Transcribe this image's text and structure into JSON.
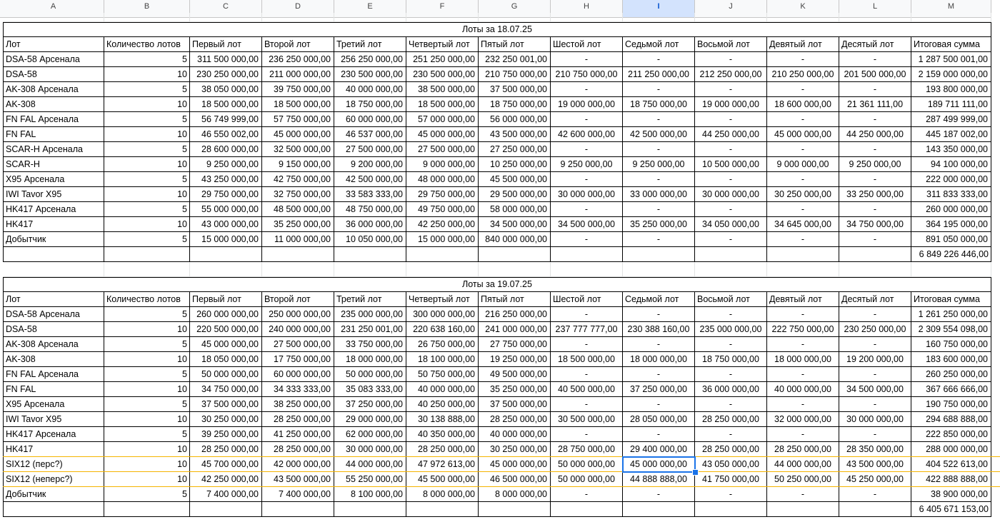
{
  "columns": [
    "A",
    "B",
    "C",
    "D",
    "E",
    "F",
    "G",
    "H",
    "I",
    "J",
    "K",
    "L",
    "M"
  ],
  "selected_column": "I",
  "headers": [
    "Лот",
    "Количество лотов",
    "Первый лот",
    "Второй лот",
    "Третий лот",
    "Четвертый лот",
    "Пятый лот",
    "Шестой лот",
    "Седьмой лот",
    "Восьмой лот",
    "Девятый лот",
    "Десятый лот",
    "Итоговая сумма"
  ],
  "tables": [
    {
      "title": "Лоты за 18.07.25",
      "rows": [
        [
          "DSA-58 Арсенала",
          "5",
          "311 500 000,00",
          "236 250 000,00",
          "256 250 000,00",
          "251 250 000,00",
          "232 250 001,00",
          "-",
          "-",
          "-",
          "-",
          "-",
          "1 287 500 001,00"
        ],
        [
          "DSA-58",
          "10",
          "230 250 000,00",
          "211 000 000,00",
          "230 500 000,00",
          "230 500 000,00",
          "210 750 000,00",
          "210 750 000,00",
          "211 250 000,00",
          "212 250 000,00",
          "210 250 000,00",
          "201 500 000,00",
          "2 159 000 000,00"
        ],
        [
          "AK-308 Арсенала",
          "5",
          "38 050 000,00",
          "39 750 000,00",
          "40 000 000,00",
          "38 500 000,00",
          "37 500 000,00",
          "-",
          "-",
          "-",
          "-",
          "-",
          "193 800 000,00"
        ],
        [
          "AK-308",
          "10",
          "18 500 000,00",
          "18 500 000,00",
          "18 750 000,00",
          "18 500 000,00",
          "18 750 000,00",
          "19 000 000,00",
          "18 750 000,00",
          "19 000 000,00",
          "18 600 000,00",
          "21 361 111,00",
          "189 711 111,00"
        ],
        [
          "FN FAL Арсенала",
          "5",
          "56 749 999,00",
          "57 750 000,00",
          "60 000 000,00",
          "57 000 000,00",
          "56 000 000,00",
          "-",
          "-",
          "-",
          "-",
          "-",
          "287 499 999,00"
        ],
        [
          "FN FAL",
          "10",
          "46 550 002,00",
          "45 000 000,00",
          "46 537 000,00",
          "45 000 000,00",
          "43 500 000,00",
          "42 600 000,00",
          "42 500 000,00",
          "44 250 000,00",
          "45 000 000,00",
          "44 250 000,00",
          "445 187 002,00"
        ],
        [
          "SCAR-H Арсенала",
          "5",
          "28 600 000,00",
          "32 500 000,00",
          "27 500 000,00",
          "27 500 000,00",
          "27 250 000,00",
          "-",
          "-",
          "-",
          "-",
          "-",
          "143 350 000,00"
        ],
        [
          "SCAR-H",
          "10",
          "9 250 000,00",
          "9 150 000,00",
          "9 200 000,00",
          "9 000 000,00",
          "10 250 000,00",
          "9 250 000,00",
          "9 250 000,00",
          "10 500 000,00",
          "9 000 000,00",
          "9 250 000,00",
          "94 100 000,00"
        ],
        [
          "X95 Арсенала",
          "5",
          "43 250 000,00",
          "42 750 000,00",
          "42 500 000,00",
          "48 000 000,00",
          "45 500 000,00",
          "-",
          "-",
          "-",
          "-",
          "-",
          "222 000 000,00"
        ],
        [
          "IWI Tavor X95",
          "10",
          "29 750 000,00",
          "32 750 000,00",
          "33 583 333,00",
          "29 750 000,00",
          "29 500 000,00",
          "30 000 000,00",
          "33 000 000,00",
          "30 000 000,00",
          "30 250 000,00",
          "33 250 000,00",
          "311 833 333,00"
        ],
        [
          "HK417 Арсенала",
          "5",
          "55 000 000,00",
          "48 500 000,00",
          "48 750 000,00",
          "49 750 000,00",
          "58 000 000,00",
          "-",
          "-",
          "-",
          "-",
          "-",
          "260 000 000,00"
        ],
        [
          "HK417",
          "10",
          "43 000 000,00",
          "35 250 000,00",
          "36 000 000,00",
          "42 250 000,00",
          "34 500 000,00",
          "34 500 000,00",
          "35 250 000,00",
          "34 050 000,00",
          "34 645 000,00",
          "34 750 000,00",
          "364 195 000,00"
        ],
        [
          "Добытчик",
          "5",
          "15 000 000,00",
          "11 000 000,00",
          "10 050 000,00",
          "15 000 000,00",
          "840 000 000,00",
          "-",
          "-",
          "-",
          "-",
          "-",
          "891 050 000,00"
        ]
      ],
      "total": "6 849 226 446,00"
    },
    {
      "title": "Лоты за 19.07.25",
      "rows": [
        [
          "DSA-58 Арсенала",
          "5",
          "260 000 000,00",
          "250 000 000,00",
          "235 000 000,00",
          "300 000 000,00",
          "216 250 000,00",
          "-",
          "-",
          "-",
          "-",
          "-",
          "1 261 250 000,00"
        ],
        [
          "DSA-58",
          "10",
          "220 500 000,00",
          "240 000 000,00",
          "231 250 001,00",
          "220 638 160,00",
          "241 000 000,00",
          "237 777 777,00",
          "230 388 160,00",
          "235 000 000,00",
          "222 750 000,00",
          "230 250 000,00",
          "2 309 554 098,00"
        ],
        [
          "AK-308 Арсенала",
          "5",
          "45 000 000,00",
          "27 500 000,00",
          "33 750 000,00",
          "26 750 000,00",
          "27 750 000,00",
          "-",
          "-",
          "-",
          "-",
          "-",
          "160 750 000,00"
        ],
        [
          "AK-308",
          "10",
          "18 050 000,00",
          "17 750 000,00",
          "18 000 000,00",
          "18 100 000,00",
          "19 250 000,00",
          "18 500 000,00",
          "18 000 000,00",
          "18 750 000,00",
          "18 000 000,00",
          "19 200 000,00",
          "183 600 000,00"
        ],
        [
          "FN FAL Арсенала",
          "5",
          "50 000 000,00",
          "60 000 000,00",
          "50 000 000,00",
          "50 750 000,00",
          "49 500 000,00",
          "-",
          "-",
          "-",
          "-",
          "-",
          "260 250 000,00"
        ],
        [
          "FN FAL",
          "10",
          "34 750 000,00",
          "34 333 333,00",
          "35 083 333,00",
          "40 000 000,00",
          "35 250 000,00",
          "40 500 000,00",
          "37 250 000,00",
          "36 000 000,00",
          "40 000 000,00",
          "34 500 000,00",
          "367 666 666,00"
        ],
        [
          "X95 Арсенала",
          "5",
          "37 500 000,00",
          "38 250 000,00",
          "37 250 000,00",
          "40 250 000,00",
          "37 500 000,00",
          "-",
          "-",
          "-",
          "-",
          "-",
          "190 750 000,00"
        ],
        [
          "IWI Tavor X95",
          "10",
          "30 250 000,00",
          "28 250 000,00",
          "29 000 000,00",
          "30 138 888,00",
          "28 250 000,00",
          "30 500 000,00",
          "28 050 000,00",
          "28 250 000,00",
          "32 000 000,00",
          "30 000 000,00",
          "294 688 888,00"
        ],
        [
          "HK417 Арсенала",
          "5",
          "39 250 000,00",
          "41 250 000,00",
          "62 000 000,00",
          "40 350 000,00",
          "40 000 000,00",
          "-",
          "-",
          "-",
          "-",
          "-",
          "222 850 000,00"
        ],
        [
          "HK417",
          "10",
          "28 250 000,00",
          "28 250 000,00",
          "30 000 000,00",
          "28 250 000,00",
          "30 250 000,00",
          "28 750 000,00",
          "29 400 000,00",
          "28 250 000,00",
          "28 250 000,00",
          "28 350 000,00",
          "288 000 000,00"
        ],
        [
          "SIX12 (перс?)",
          "10",
          "45 700 000,00",
          "42 000 000,00",
          "44 000 000,00",
          "47 972 613,00",
          "45 000 000,00",
          "50 000 000,00",
          "45 000 000,00",
          "43 050 000,00",
          "44 000 000,00",
          "43 500 000,00",
          "404 522 613,00"
        ],
        [
          "SIX12 (неперс?)",
          "10",
          "42 250 000,00",
          "43 500 000,00",
          "55 250 000,00",
          "45 500 000,00",
          "46 500 000,00",
          "50 000 000,00",
          "44 888 888,00",
          "41 750 000,00",
          "50 250 000,00",
          "45 250 000,00",
          "422 888 888,00"
        ],
        [
          "Добытчик",
          "5",
          "7 400 000,00",
          "7 400 000,00",
          "8 100 000,00",
          "8 000 000,00",
          "8 000 000,00",
          "-",
          "-",
          "-",
          "-",
          "-",
          "38 900 000,00"
        ]
      ],
      "total": "6 405 671 153,00"
    }
  ],
  "highlighted_rows": [
    "SIX12 (перс?)",
    "SIX12 (неперс?)"
  ],
  "active_cell": {
    "column": "I",
    "row_label": "SIX12 (перс?)",
    "value": "45 000 000,00"
  },
  "colors": {
    "header_bg": "#f8f9fa",
    "selected_header_bg": "#d3e3fd",
    "selection_border": "#1a73e8",
    "row_highlight": "#f4b400",
    "gridline": "#e2e3e3",
    "table_border": "#000000"
  }
}
